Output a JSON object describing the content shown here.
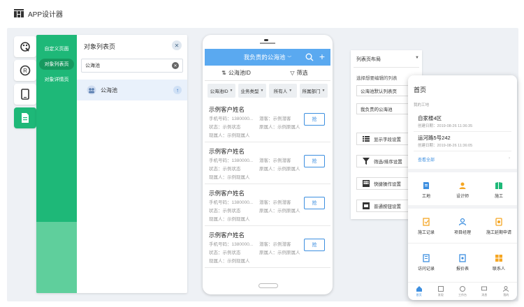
{
  "app": {
    "title": "APP设计器"
  },
  "iconbar": {
    "items": [
      "palette-icon",
      "registered-icon",
      "phone-icon",
      "document-icon"
    ]
  },
  "nav": {
    "items": [
      {
        "label": "自定义页面",
        "active": false
      },
      {
        "label": "对象列表页",
        "active": true
      },
      {
        "label": "对象详情页",
        "active": false
      }
    ]
  },
  "list_panel": {
    "title": "对象列表页",
    "search_value": "公海池",
    "row_label": "公海池"
  },
  "phone": {
    "header_title": "我负责的公海池",
    "tabs": [
      "公海池ID",
      "筛选"
    ],
    "filters": [
      "公海池ID",
      "业务类型",
      "所有人",
      "所属部门"
    ],
    "cards": [
      {
        "name": "示例客户姓名",
        "phone": "手机号码：1380000...",
        "potential": "潜客：示例潜客",
        "status": "状态：示例状态",
        "owner": "原属人：示例原属人",
        "owner2": "现属人：示例现属人",
        "button": "抢"
      },
      {
        "name": "示例客户姓名",
        "phone": "手机号码：1380000...",
        "potential": "潜客：示例潜客",
        "status": "状态：示例状态",
        "owner": "原属人：示例原属人",
        "owner2": "现属人：示例现属人",
        "button": "抢"
      },
      {
        "name": "示例客户姓名",
        "phone": "手机号码：1380000...",
        "potential": "潜客：示例潜客",
        "status": "状态：示例状态",
        "owner": "原属人：示例原属人",
        "owner2": "现属人：示例现属人",
        "button": "抢"
      },
      {
        "name": "示例客户姓名",
        "phone": "手机号码：1380000...",
        "potential": "潜客：示例潜客",
        "status": "状态：示例状态",
        "owner": "原属人：示例原属人",
        "owner2": "现属人：示例现属人",
        "button": "抢"
      }
    ]
  },
  "layout_panel": {
    "title": "列表页布局",
    "label": "选择想要编辑的列表",
    "selects": [
      "公海池默认列表页",
      "我负责的公海池"
    ],
    "buttons": [
      "显示字段设置",
      "筛选/排序设置",
      "快捷操作设置",
      "普通按钮设置"
    ]
  },
  "phone2": {
    "title": "首页",
    "section": "我的工地",
    "sites": [
      {
        "name": "自家楼4区",
        "date": "创建日期：2019-08-26 11:36:35"
      },
      {
        "name": "运河路5号242",
        "date": "创建日期：2019-08-26 11:36:05"
      }
    ],
    "view_all": "查看全部",
    "grid1": [
      {
        "label": "工地",
        "icon": "site-icon"
      },
      {
        "label": "设计师",
        "icon": "designer-icon"
      },
      {
        "label": "施工",
        "icon": "construction-icon"
      }
    ],
    "grid2": [
      {
        "label": "施工记录",
        "icon": "record-icon"
      },
      {
        "label": "项目经理",
        "icon": "manager-icon"
      },
      {
        "label": "施工延期申请",
        "icon": "delay-icon"
      },
      {
        "label": "访问记录",
        "icon": "visit-icon"
      },
      {
        "label": "报价表",
        "icon": "quote-icon"
      },
      {
        "label": "联系人",
        "icon": "contact-icon"
      }
    ],
    "tabs": [
      {
        "label": "首页",
        "active": true
      },
      {
        "label": "发现",
        "active": false
      },
      {
        "label": "工作台",
        "active": false
      },
      {
        "label": "消息",
        "active": false
      },
      {
        "label": "我的",
        "active": false
      }
    ]
  },
  "colors": {
    "green": "#1eb878",
    "blue": "#5aa9f0",
    "link": "#3d8fe0",
    "orange": "#f5a623"
  }
}
